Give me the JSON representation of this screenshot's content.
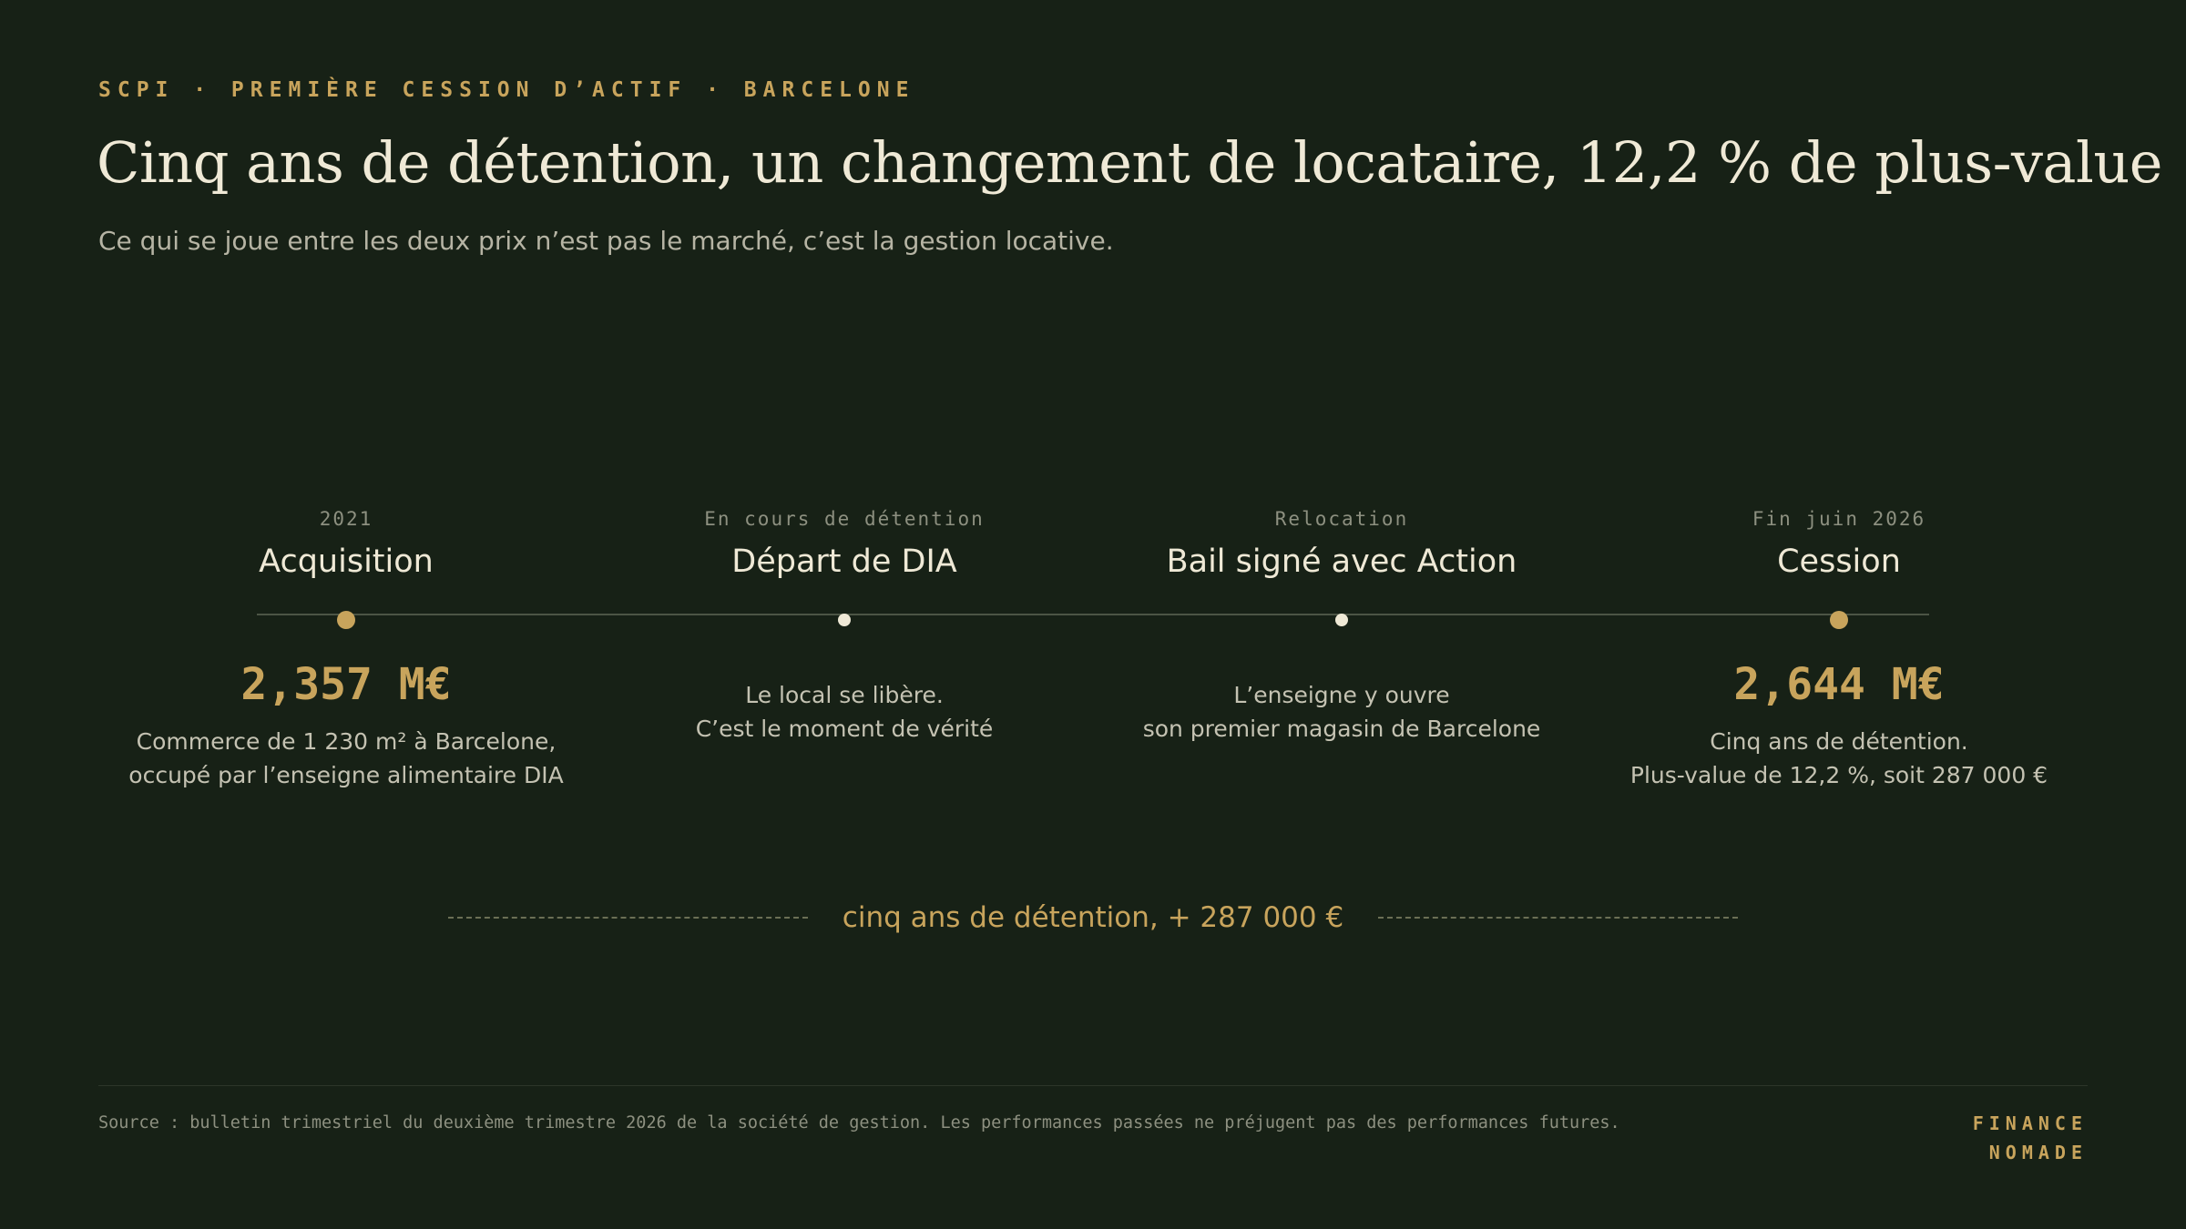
{
  "header": {
    "eyebrow": "SCPI · PREMIÈRE CESSION D’ACTIF · BARCELONE",
    "title": "Cinq ans de détention, un changement de locataire, 12,2 % de plus-value",
    "subtitle": "Ce qui se joue entre les deux prix n’est pas le marché, c’est la gestion locative."
  },
  "timeline": {
    "milestones": [
      {
        "date": "2021",
        "label": "Acquisition",
        "amount": "2,357 M€",
        "desc": [
          "Commerce de 1 230 m² à Barcelone,",
          "occupé par l’enseigne alimentaire DIA"
        ]
      },
      {
        "date": "En cours de détention",
        "label": "Départ de DIA",
        "amount": "",
        "desc": [
          "Le local se libère.",
          "C’est le moment de vérité"
        ]
      },
      {
        "date": "Relocation",
        "label": "Bail signé avec Action",
        "amount": "",
        "desc": [
          "L’enseigne y ouvre",
          "son premier magasin de Barcelone"
        ]
      },
      {
        "date": "Fin juin 2026",
        "label": "Cession",
        "amount": "2,644 M€",
        "desc": [
          "Cinq ans de détention.",
          "Plus-value de 12,2 %, soit 287 000 €"
        ]
      }
    ],
    "summary": "cinq ans de détention, + 287 000 €"
  },
  "footer": {
    "source": "Source : bulletin trimestriel du deuxième trimestre 2026 de la société de gestion. Les performances passées ne préjugent pas des performances futures.",
    "brand_line1": "FINANCE",
    "brand_line2": "NOMADE"
  },
  "colors": {
    "background": "#172116",
    "accent": "#c8a45c",
    "text": "#efe9d6",
    "muted": "#8d9080"
  }
}
